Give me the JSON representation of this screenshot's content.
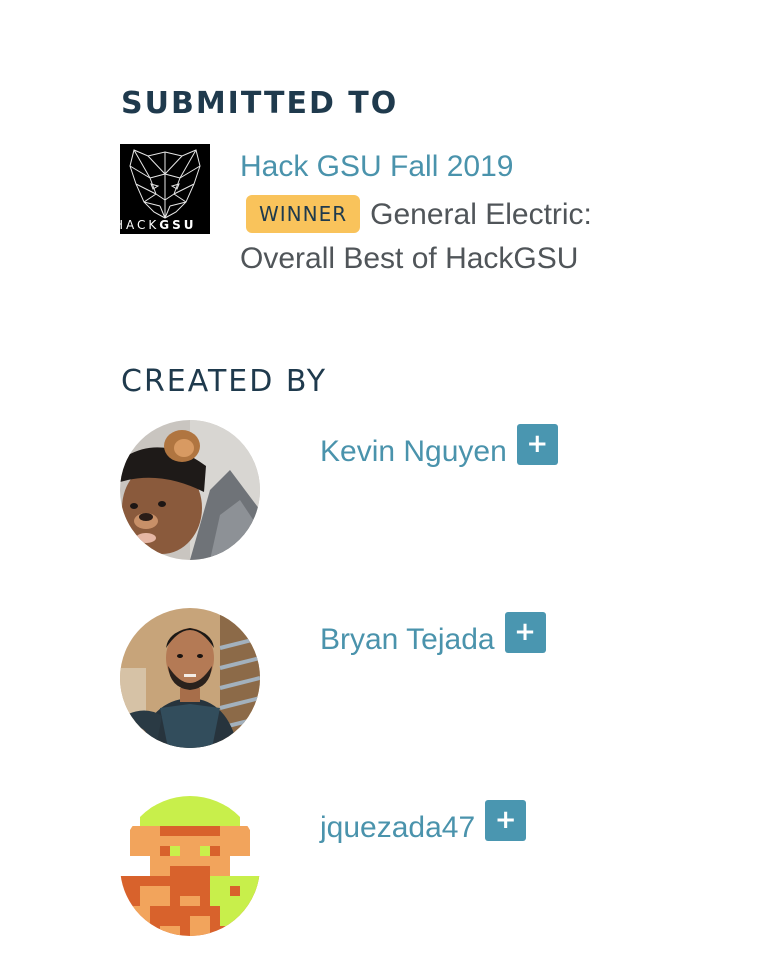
{
  "submitted": {
    "heading": "SUBMITTED TO",
    "hackathon": {
      "name": "Hack GSU Fall 2019",
      "logo_text_light": "HACK",
      "logo_text_bold": "GSU",
      "logo_icon": "panther-head-logo"
    },
    "prize": {
      "badge": "WINNER",
      "title": "General Electric: Overall Best of HackGSU"
    }
  },
  "created_by": {
    "heading": "CREATED BY",
    "members": [
      {
        "name": "Kevin Nguyen",
        "follow": "+",
        "avatar": "photo-person-dog-filter"
      },
      {
        "name": "Bryan Tejada",
        "follow": "+",
        "avatar": "photo-person-selfie"
      },
      {
        "name": "jquezada47",
        "follow": "+",
        "avatar": "pixel-art-character"
      }
    ]
  },
  "colors": {
    "heading": "#1f3a4d",
    "link": "#4a93ac",
    "badge": "#f9c35b",
    "follow_button": "#4a96b0",
    "body_text": "#505559"
  }
}
